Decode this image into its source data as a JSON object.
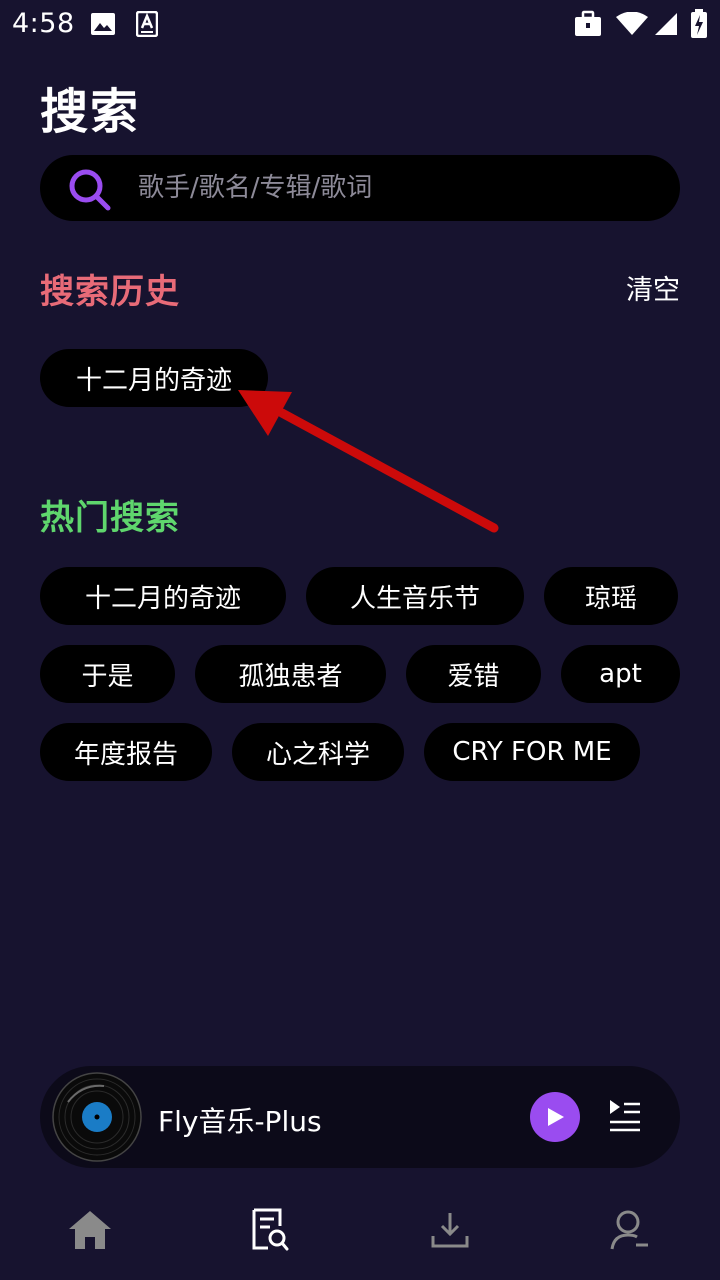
{
  "status_bar": {
    "time": "4:58",
    "icons": [
      "image-icon",
      "a-card-icon",
      "briefcase-icon",
      "wifi-icon",
      "signal-icon",
      "battery-charging-icon"
    ]
  },
  "page": {
    "title": "搜索"
  },
  "search": {
    "placeholder": "歌手/歌名/专辑/歌词",
    "value": ""
  },
  "history": {
    "heading": "搜索历史",
    "clear_label": "清空",
    "items": [
      "十二月的奇迹"
    ]
  },
  "hot": {
    "heading": "热门搜索",
    "items": [
      "十二月的奇迹",
      "人生音乐节",
      "琼瑶",
      "于是",
      "孤独患者",
      "爱错",
      "apt",
      "年度报告",
      "心之科学",
      "CRY FOR ME"
    ]
  },
  "player": {
    "title": "Fly音乐-Plus"
  },
  "nav": {
    "items": [
      "home-icon",
      "search-doc-icon",
      "download-icon",
      "profile-icon"
    ],
    "active": "search-doc-icon"
  },
  "colors": {
    "background": "#17132f",
    "chip": "#000000",
    "history_heading": "#e86b78",
    "hot_heading": "#5fd66d",
    "accent": "#9a4cf0",
    "arrow": "#cc0a0a"
  }
}
